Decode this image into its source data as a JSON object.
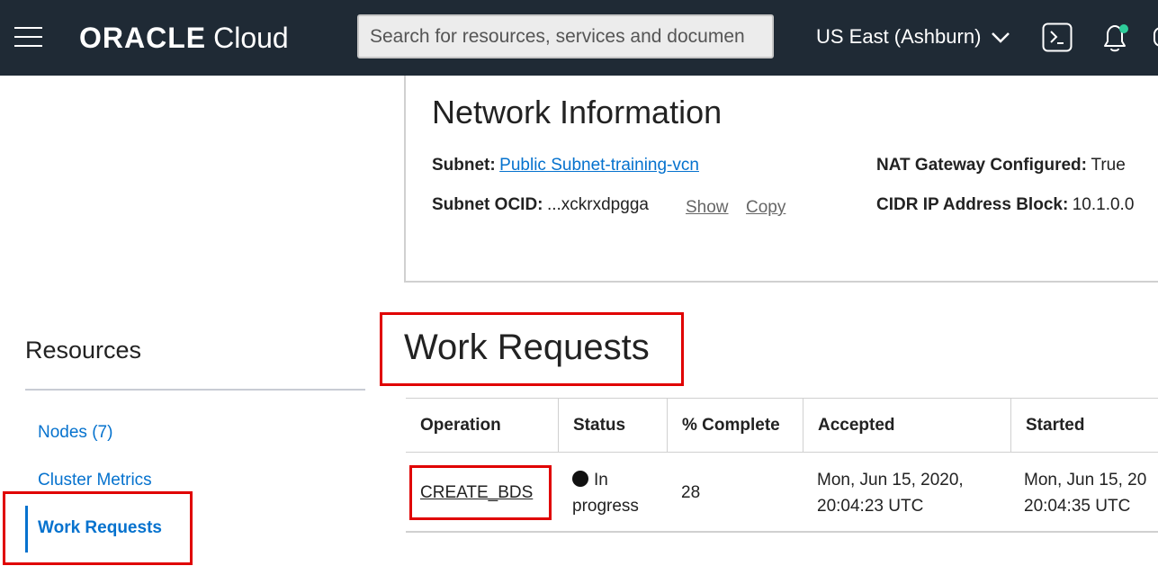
{
  "header": {
    "logo_brand": "ORACLE",
    "logo_product": "Cloud",
    "search_placeholder": "Search for resources, services and documen",
    "region": "US East (Ashburn)",
    "icons": [
      "menu-icon",
      "chevron-down-icon",
      "cloud-shell-icon",
      "bell-icon"
    ],
    "colors": {
      "bar": "#1f2a35",
      "notification_dot": "#2ecc9a"
    }
  },
  "network": {
    "title": "Network Information",
    "subnet_label": "Subnet:",
    "subnet_value": "Public Subnet-training-vcn",
    "subnet_ocid_label": "Subnet OCID:",
    "subnet_ocid_value": "...xckrxdpgga",
    "show_label": "Show",
    "copy_label": "Copy",
    "nat_label": "NAT Gateway Configured:",
    "nat_value": "True",
    "cidr_label": "CIDR IP Address Block:",
    "cidr_value": "10.1.0.0"
  },
  "resources": {
    "title": "Resources",
    "items": [
      {
        "label": "Nodes (7)"
      },
      {
        "label": "Cluster Metrics"
      },
      {
        "label": "Work Requests",
        "active": true
      }
    ]
  },
  "work_requests": {
    "title": "Work Requests",
    "columns": [
      "Operation",
      "Status",
      "% Complete",
      "Accepted",
      "Started"
    ],
    "rows": [
      {
        "operation": "CREATE_BDS",
        "status_line1": "In",
        "status_line2": "progress",
        "percent_complete": "28",
        "accepted_line1": "Mon, Jun 15, 2020,",
        "accepted_line2": "20:04:23 UTC",
        "started_line1": "Mon, Jun 15, 20",
        "started_line2": "20:04:35 UTC"
      }
    ]
  },
  "colors": {
    "link": "#0572ce",
    "highlight": "#e00000"
  }
}
